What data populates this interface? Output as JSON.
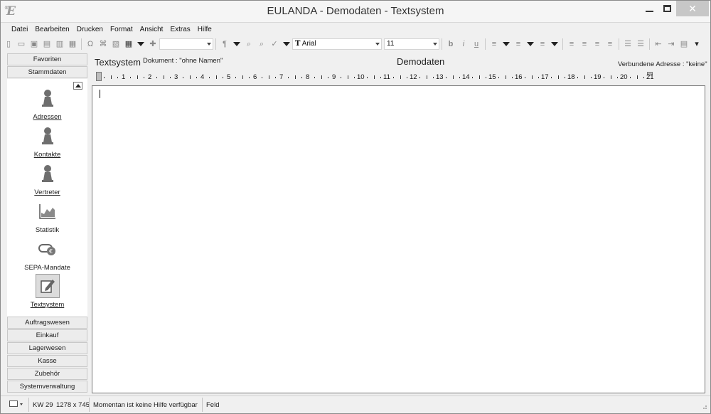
{
  "window": {
    "title": "EULANDA - Demodaten - Textsystem",
    "logo_letter": "E",
    "logo_mark": "®"
  },
  "menu": [
    {
      "label": "Datei"
    },
    {
      "label": "Bearbeiten"
    },
    {
      "label": "Drucken"
    },
    {
      "label": "Format"
    },
    {
      "label": "Ansicht"
    },
    {
      "label": "Extras"
    },
    {
      "label": "Hilfe"
    }
  ],
  "toolbar": {
    "style_combo_value": "",
    "font_combo_value": "Arial",
    "font_combo_prefix": "T",
    "size_combo_value": "11"
  },
  "nav": {
    "headers_top": [
      "Favoriten",
      "Stammdaten"
    ],
    "items": [
      {
        "label": "Adressen",
        "icon": "pawn-icon"
      },
      {
        "label": "Kontakte",
        "icon": "pawn-icon"
      },
      {
        "label": "Vertreter",
        "icon": "pawn-icon"
      },
      {
        "label": "Statistik",
        "icon": "chart-icon"
      },
      {
        "label": "SEPA-Mandate",
        "icon": "sepa-icon"
      },
      {
        "label": "Textsystem",
        "icon": "pen-document-icon"
      }
    ],
    "headers_bottom": [
      "Auftragswesen",
      "Einkauf",
      "Lagerwesen",
      "Kasse",
      "Zubehör",
      "Systemverwaltung"
    ]
  },
  "editor": {
    "title": "Textsystem",
    "document_label": "Dokument : \"ohne Namen\"",
    "center_title": "Demodaten",
    "linked_address": "Verbundene Adresse : \"keine\"",
    "ruler_numbers": [
      "1",
      "2",
      "3",
      "4",
      "5",
      "6",
      "7",
      "8",
      "9",
      "10",
      "11",
      "12",
      "13",
      "14",
      "15",
      "16",
      "17",
      "18",
      "19",
      "20",
      "21"
    ]
  },
  "status": {
    "kw": "KW 29",
    "resolution": "1278 x 745",
    "help": "Momentan ist keine Hilfe verfügbar",
    "field": "Feld"
  }
}
